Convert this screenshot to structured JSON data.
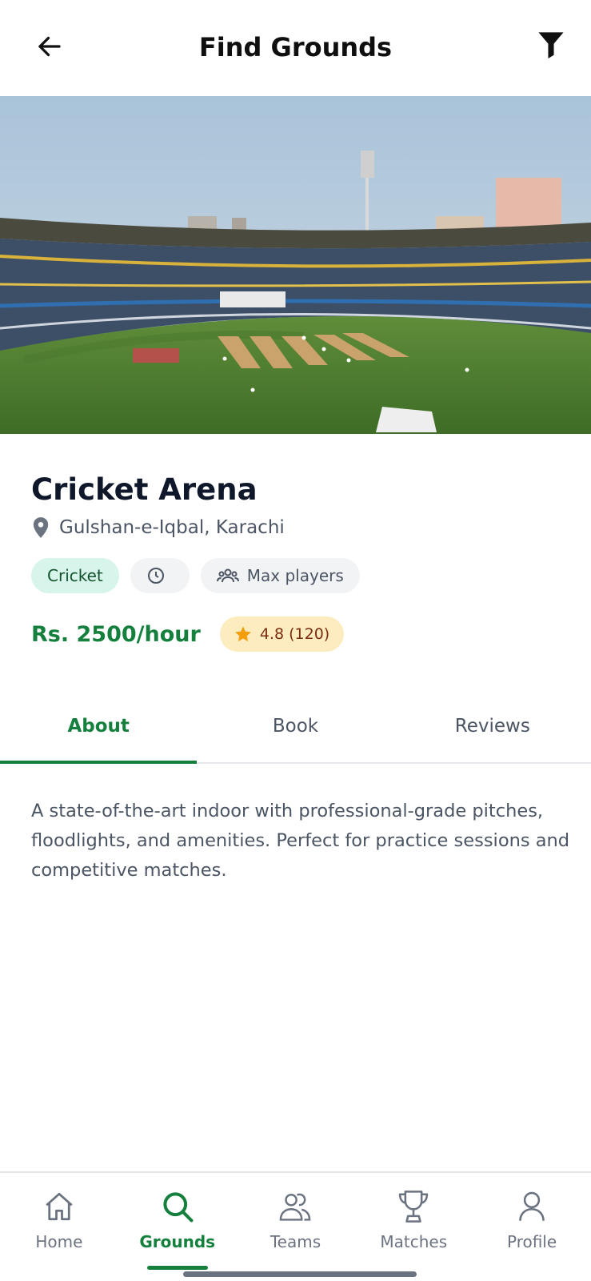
{
  "header": {
    "title": "Find Grounds",
    "back_icon": "arrow-left-icon",
    "filter_icon": "filter-icon"
  },
  "hero": {
    "image_subject": "cricket stadium"
  },
  "ground": {
    "name": "Cricket Arena",
    "location": "Gulshan-e-Iqbal, Karachi",
    "sport": "Cricket",
    "timing": "",
    "max_players_label": "Max players",
    "price": "Rs. 2500/hour",
    "rating": "4.8 (120)"
  },
  "tabs": [
    {
      "label": "About",
      "active": true
    },
    {
      "label": "Book",
      "active": false
    },
    {
      "label": "Reviews",
      "active": false
    }
  ],
  "about_text": "A state-of-the-art indoor with professional-grade pitches, floodlights, and amenities. Perfect for practice sessions and competitive matches.",
  "bottom_nav": [
    {
      "label": "Home",
      "icon": "home-icon",
      "active": false
    },
    {
      "label": "Grounds",
      "icon": "search-icon",
      "active": true
    },
    {
      "label": "Teams",
      "icon": "teams-icon",
      "active": false
    },
    {
      "label": "Matches",
      "icon": "trophy-icon",
      "active": false
    },
    {
      "label": "Profile",
      "icon": "profile-icon",
      "active": false
    }
  ],
  "colors": {
    "accent": "#15803d",
    "chip_sport_bg": "#d7f5ea",
    "rating_bg": "#fdecc0",
    "star": "#f59e0b"
  }
}
